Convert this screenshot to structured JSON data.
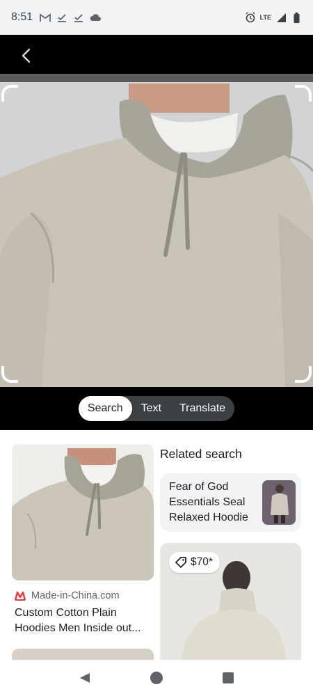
{
  "status_bar": {
    "time": "8:51",
    "network_label": "LTE",
    "icons_left": [
      "gmail-icon",
      "download-check-icon",
      "download-check-icon",
      "cloud-icon"
    ],
    "icons_right": [
      "alarm-icon",
      "signal-icon",
      "battery-icon"
    ]
  },
  "header": {
    "back_icon": "chevron-left-icon"
  },
  "modes": {
    "tabs": [
      "Search",
      "Text",
      "Translate"
    ],
    "selected": "Search"
  },
  "results": {
    "left_card": {
      "source": "Made-in-China.com",
      "title": "Custom Cotton Plain Hoodies Men Inside out...",
      "source_logo_color": "#e53935"
    },
    "related": {
      "heading": "Related search",
      "item_label": "Fear of God Essentials Seal Relaxed Hoodie"
    },
    "right_card": {
      "price": "$70*"
    }
  },
  "nav_bar": {
    "buttons": [
      "back-triangle-icon",
      "home-circle-icon",
      "recents-square-icon"
    ]
  },
  "colors": {
    "accent_dark": "#000000",
    "chip_bg": "#3c4043",
    "hoodie": "#c9c4b6"
  }
}
